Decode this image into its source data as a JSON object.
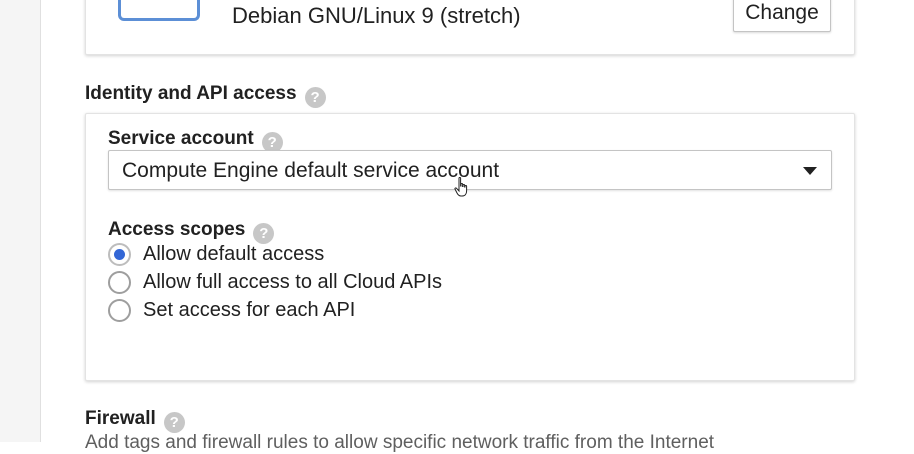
{
  "boot_disk": {
    "os_name": "Debian GNU/Linux 9 (stretch)",
    "change_label": "Change",
    "icon": "disk-image-icon"
  },
  "identity": {
    "title": "Identity and API access",
    "help_glyph": "?",
    "service_account": {
      "label": "Service account",
      "selected": "Compute Engine default service account"
    },
    "access_scopes": {
      "label": "Access scopes",
      "options": [
        {
          "label": "Allow default access",
          "selected": true
        },
        {
          "label": "Allow full access to all Cloud APIs",
          "selected": false
        },
        {
          "label": "Set access for each API",
          "selected": false
        }
      ]
    }
  },
  "firewall": {
    "title": "Firewall",
    "description": "Add tags and firewall rules to allow specific network traffic from the Internet"
  },
  "colors": {
    "accent": "#3367d6",
    "help_icon": "#c7c7c7",
    "os_icon": "#5c8fd6"
  }
}
